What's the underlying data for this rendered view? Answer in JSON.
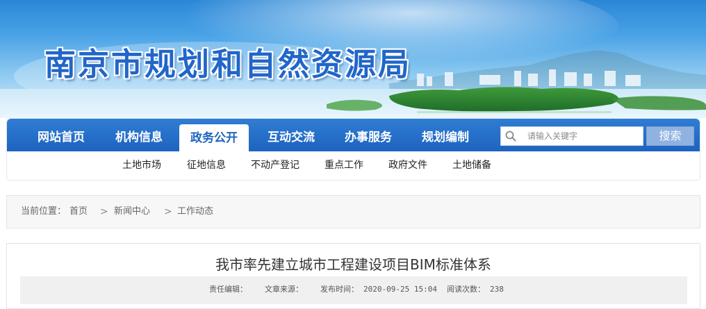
{
  "header": {
    "site_title": "南京市规划和自然资源局"
  },
  "nav": {
    "main_items": [
      {
        "label": "网站首页",
        "active": false
      },
      {
        "label": "机构信息",
        "active": false
      },
      {
        "label": "政务公开",
        "active": true
      },
      {
        "label": "互动交流",
        "active": false
      },
      {
        "label": "办事服务",
        "active": false
      },
      {
        "label": "规划编制",
        "active": false
      }
    ],
    "sub_items": [
      "土地市场",
      "征地信息",
      "不动产登记",
      "重点工作",
      "政府文件",
      "土地储备"
    ],
    "search": {
      "placeholder": "请输入关键字",
      "value": "",
      "button_label": "搜索",
      "icon": "search-icon"
    }
  },
  "breadcrumb": {
    "prefix": "当前位置：",
    "items": [
      "首页",
      "新闻中心",
      "工作动态"
    ],
    "separator": ">"
  },
  "article": {
    "title": "我市率先建立城市工程建设项目BIM标准体系",
    "meta": {
      "editor_label": "责任编辑：",
      "editor": "",
      "source_label": "文章来源：",
      "source": "",
      "date_label": "发布时间：",
      "date": "2020-09-25 15:04",
      "views_label": "阅读次数：",
      "views": "238"
    }
  },
  "colors": {
    "nav_blue": "#1e63bf",
    "title_blue": "#2166c9",
    "search_button": "#8fb2e0"
  }
}
